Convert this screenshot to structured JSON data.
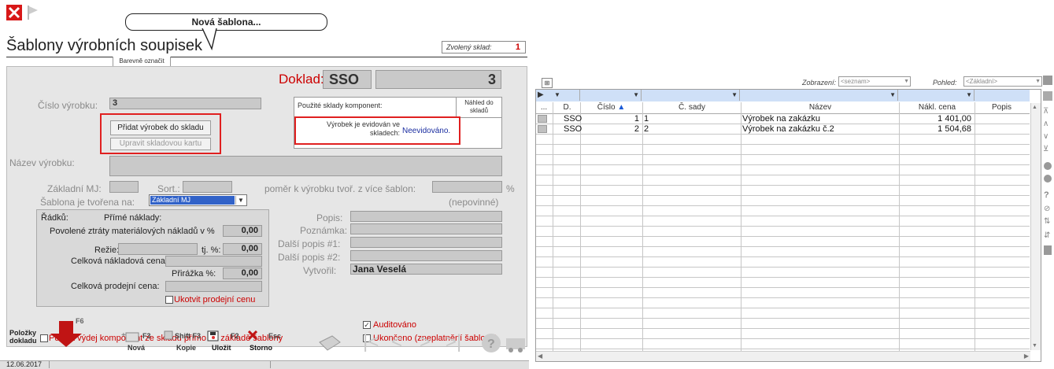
{
  "header": {
    "close_icon": "close-x-icon",
    "flag_icon": "flag-icon",
    "callout_text": "Nová šablona...",
    "title": "Šablony výrobních soupisek",
    "tab_label": "Barevně označit",
    "warehouse_label": "Zvolený sklad:",
    "warehouse_value": "1"
  },
  "form": {
    "doklad_label": "Doklad:",
    "doklad_type": "SSO",
    "doklad_number": "3",
    "cislo_label": "Číslo výrobku:",
    "cislo_value": "3",
    "add_to_stock_button": "Přidat výrobek do skladu",
    "edit_stock_card_button": "Upravit skladovou kartu",
    "components_label": "Použité sklady komponent:",
    "preview_label": "Náhled do skladů",
    "evidence_label": "Výrobek je evidován ve skladech:",
    "evidence_value": "Neevidováno.",
    "name_label": "Název výrobku:",
    "name_value": "",
    "basic_unit_label": "Základní MJ:",
    "sort_label": "Sort.:",
    "ratio_label": "poměr k výrobku tvoř. z více šablon:",
    "ratio_unit": "%",
    "optional_label": "(nepovinné)",
    "template_based_label": "Šablona je tvořena na:",
    "template_based_value": "Základní MJ",
    "rows_label": "Řádků:",
    "direct_costs_label": "Přímé náklady:",
    "allowed_loss_label": "Povolené ztráty materiálových nákladů v %",
    "allowed_loss_value": "0,00",
    "overhead_label": "Režie:",
    "overhead_pct_label": "tj. %:",
    "overhead_pct_value": "0,00",
    "total_cost_label": "Celková nákladová cena:",
    "markup_label": "Přirážka %:",
    "markup_value": "0,00",
    "total_sale_label": "Celková prodejní cena:",
    "fix_price_label": "Ukotvit prodejní cenu",
    "description_label": "Popis:",
    "note_label": "Poznámka:",
    "desc1_label": "Další popis #1:",
    "desc2_label": "Další popis #2:",
    "created_by_label": "Vytvořil:",
    "created_by_value": "Jana Veselá",
    "audited_label": "Auditováno",
    "audited_checked": true,
    "allow_issue_label": "Povolit výdej komponent ze skladu přímo na základě šablony",
    "finished_label": "Ukončeno (zneplatnění šablony)"
  },
  "toolbar": {
    "items_button": "Položky dokladu",
    "items_key": "F6",
    "new_key": "F3",
    "new_label": "Nová",
    "copy_key": "Shift F3",
    "copy_label": "Kopie",
    "save_key": "F2",
    "save_label": "Uložit",
    "cancel_key": "Esc",
    "cancel_label": "Storno"
  },
  "statusbar": {
    "date": "12.06.2017"
  },
  "grid": {
    "view_label": "Zobrazení:",
    "view_value": "<seznam>",
    "perspective_label": "Pohled:",
    "perspective_value": "<Základní>",
    "columns": [
      "...",
      "D.",
      "Číslo",
      "Č. sady",
      "Název",
      "Nákl. cena",
      "Popis"
    ],
    "rows": [
      {
        "d": "SSO",
        "cislo": "1",
        "sada": "1",
        "nazev": "Výrobek na zakázku",
        "cena": "1 401,00",
        "popis": ""
      },
      {
        "d": "SSO",
        "cislo": "2",
        "sada": "2",
        "nazev": "Výrobek na zakázku č.2",
        "cena": "1 504,68",
        "popis": ""
      }
    ]
  }
}
